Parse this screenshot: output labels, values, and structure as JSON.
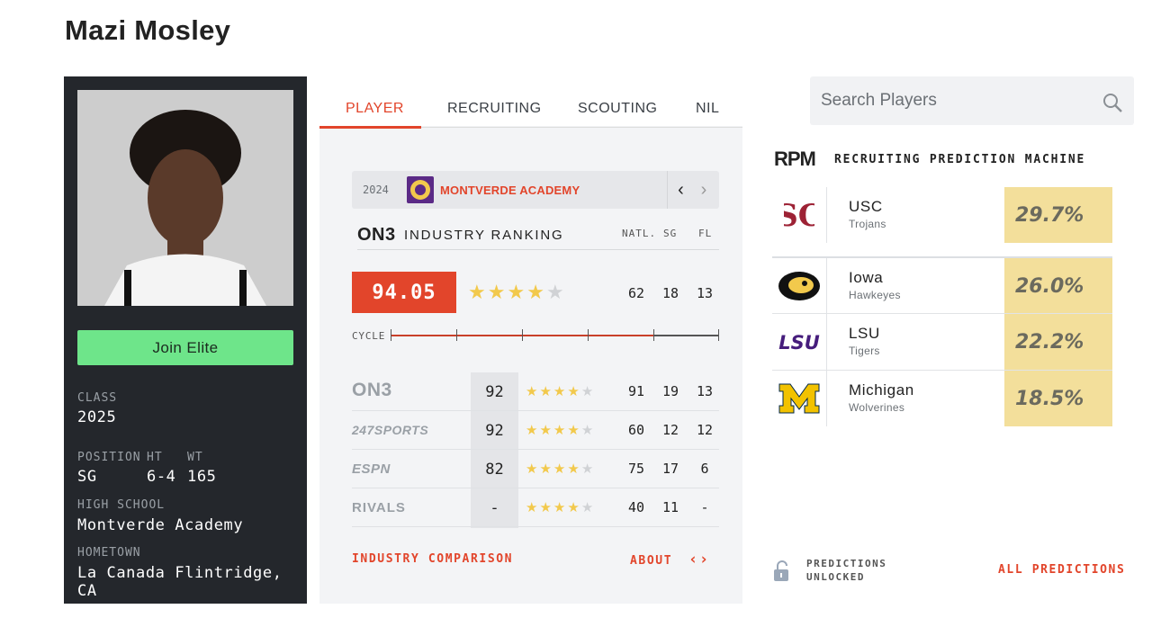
{
  "page_title": "Mazi Mosley",
  "card": {
    "join_label": "Join Elite",
    "class_label": "CLASS",
    "class_value": "2025",
    "position_label": "POSITION",
    "position_value": "SG",
    "ht_label": "HT",
    "ht_value": "6-4",
    "wt_label": "WT",
    "wt_value": "165",
    "school_label": "HIGH SCHOOL",
    "school_value": "Montverde Academy",
    "hometown_label": "HOMETOWN",
    "hometown_value": "La Canada Flintridge, CA"
  },
  "tabs": [
    "PLAYER",
    "RECRUITING",
    "SCOUTING",
    "NIL"
  ],
  "school_bar": {
    "year": "2024",
    "name": "MONTVERDE ACADEMY"
  },
  "ranking": {
    "logo": "ON3",
    "title": "INDUSTRY RANKING",
    "cols": [
      "NATL.",
      "SG",
      "FL"
    ],
    "score": "94.05",
    "stars": 4,
    "natl": "62",
    "pos": "18",
    "state": "13",
    "cycle_label": "CYCLE"
  },
  "services": [
    {
      "logo": "ON3",
      "score": "92",
      "stars": 4,
      "natl": "91",
      "pos": "19",
      "state": "13"
    },
    {
      "logo": "247SPORTS",
      "score": "92",
      "stars": 4,
      "natl": "60",
      "pos": "12",
      "state": "12"
    },
    {
      "logo": "ESPN",
      "score": "82",
      "stars": 4,
      "natl": "75",
      "pos": "17",
      "state": "6"
    },
    {
      "logo": "RIVALS",
      "score": "-",
      "stars": 4,
      "natl": "40",
      "pos": "11",
      "state": "-"
    }
  ],
  "links": {
    "comparison": "INDUSTRY COMPARISON",
    "about": "ABOUT"
  },
  "search": {
    "placeholder": "Search Players"
  },
  "rpm": {
    "logo": "RPM",
    "title": "RECRUITING PREDICTION MACHINE",
    "predictions": [
      {
        "team": "USC",
        "mascot": "Trojans",
        "pct": "29.7%",
        "pct_value": 29.7,
        "logo": "usc-logo"
      },
      {
        "team": "Iowa",
        "mascot": "Hawkeyes",
        "pct": "26.0%",
        "pct_value": 26.0,
        "logo": "iowa-logo"
      },
      {
        "team": "LSU",
        "mascot": "Tigers",
        "pct": "22.2%",
        "pct_value": 22.2,
        "logo": "lsu-logo"
      },
      {
        "team": "Michigan",
        "mascot": "Wolverines",
        "pct": "18.5%",
        "pct_value": 18.5,
        "logo": "michigan-logo"
      }
    ],
    "unlocked_line1": "PREDICTIONS",
    "unlocked_line2": "UNLOCKED",
    "all_predictions": "ALL PREDICTIONS"
  },
  "colors": {
    "accent": "#e2452b",
    "join": "#6ee58a",
    "card_bg": "#24272c",
    "pct_bg": "#f3df9b",
    "star": "#f2c94c"
  }
}
